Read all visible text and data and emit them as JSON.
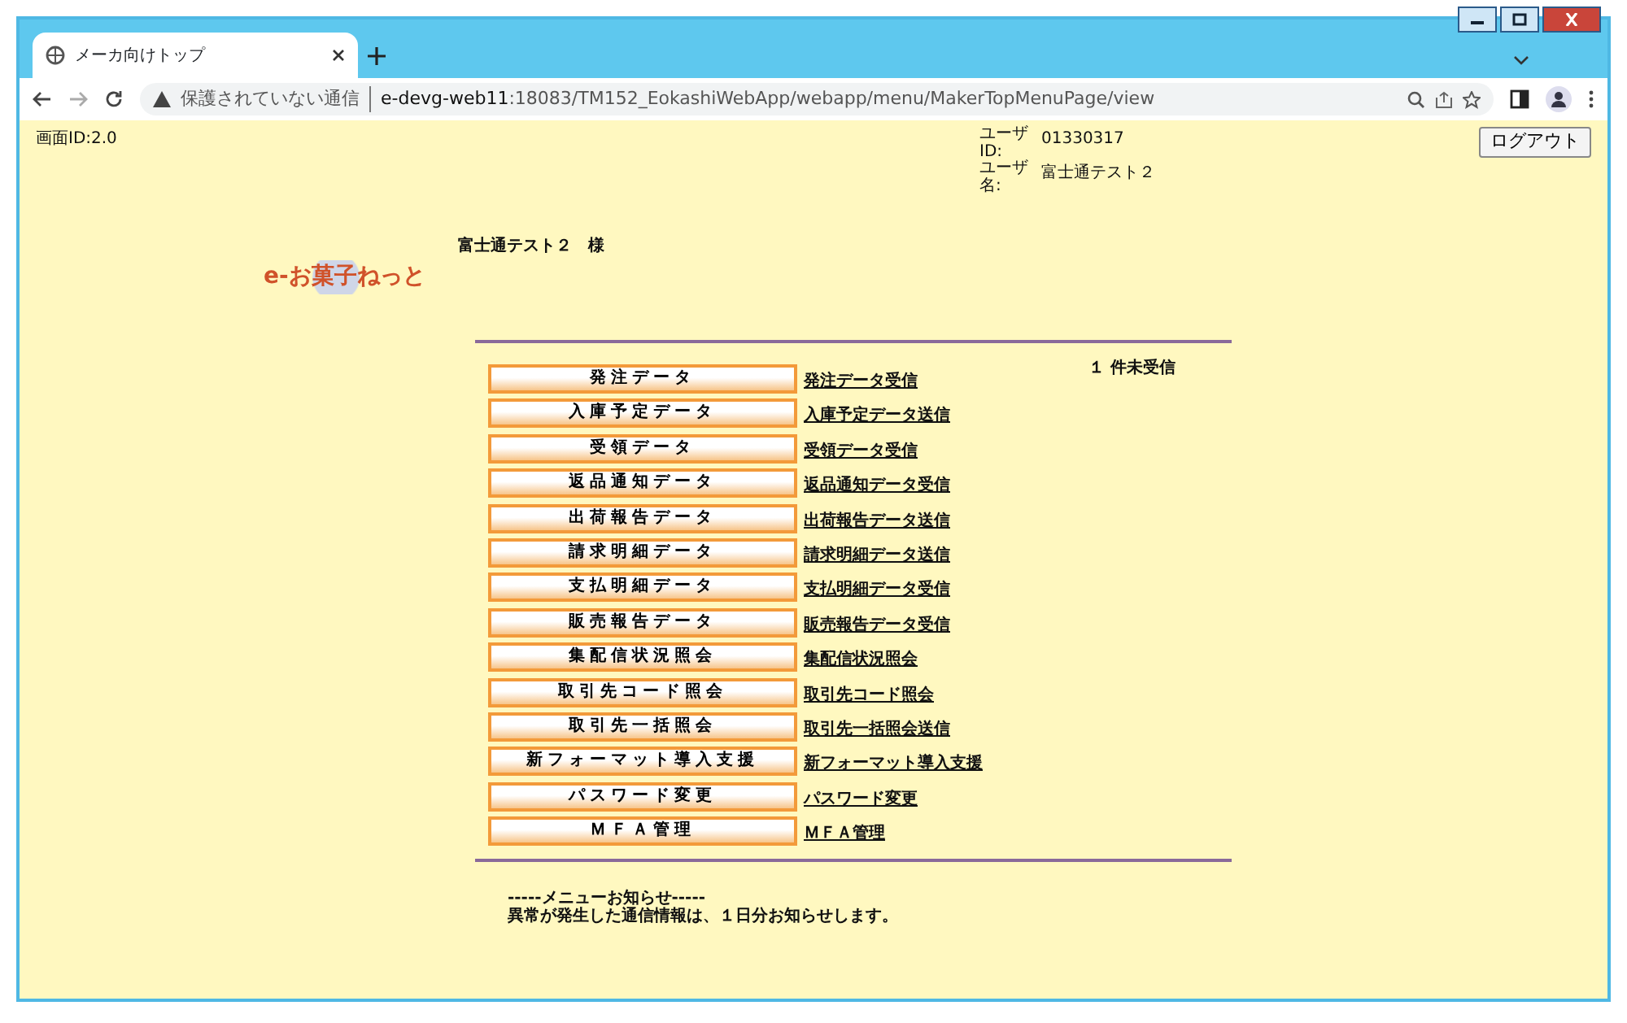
{
  "browser": {
    "tab_title": "メーカ向けトップ",
    "security_label": "保護されていない通信",
    "url_host": "e-devg-web11",
    "url_rest": ":18083/TM152_EokashiWebApp/webapp/menu/MakerTopMenuPage/view"
  },
  "page": {
    "screen_id": "画面ID:2.0",
    "user_fields": [
      {
        "label": "ユーザID:",
        "value": "01330317"
      },
      {
        "label": "ユーザ名:",
        "value": "富士通テスト２"
      }
    ],
    "logout_button": "ログアウト",
    "logo_text": "e-お菓子ねっと",
    "greeting": "富士通テスト２　様",
    "menu": [
      {
        "button": "発注データ",
        "link": "発注データ受信",
        "status": "１ 件未受信"
      },
      {
        "button": "入庫予定データ",
        "link": "入庫予定データ送信"
      },
      {
        "button": "受領データ",
        "link": "受領データ受信"
      },
      {
        "button": "返品通知データ",
        "link": "返品通知データ受信"
      },
      {
        "button": "出荷報告データ",
        "link": "出荷報告データ送信"
      },
      {
        "button": "請求明細データ",
        "link": "請求明細データ送信"
      },
      {
        "button": "支払明細データ",
        "link": "支払明細データ受信"
      },
      {
        "button": "販売報告データ",
        "link": "販売報告データ受信"
      },
      {
        "button": "集配信状況照会",
        "link": "集配信状況照会"
      },
      {
        "button": "取引先コード照会",
        "link": "取引先コード照会"
      },
      {
        "button": "取引先一括照会",
        "link": "取引先一括照会送信"
      },
      {
        "button": "新フォーマット導入支援",
        "link": "新フォーマット導入支援"
      },
      {
        "button": "パスワード変更",
        "link": "パスワード変更"
      },
      {
        "button": "ＭＦＡ管理",
        "link": "ＭＦＡ管理"
      }
    ],
    "notice_title": "-----メニューお知らせ-----",
    "notice_text": "異常が発生した通信情報は、１日分お知らせします。"
  }
}
